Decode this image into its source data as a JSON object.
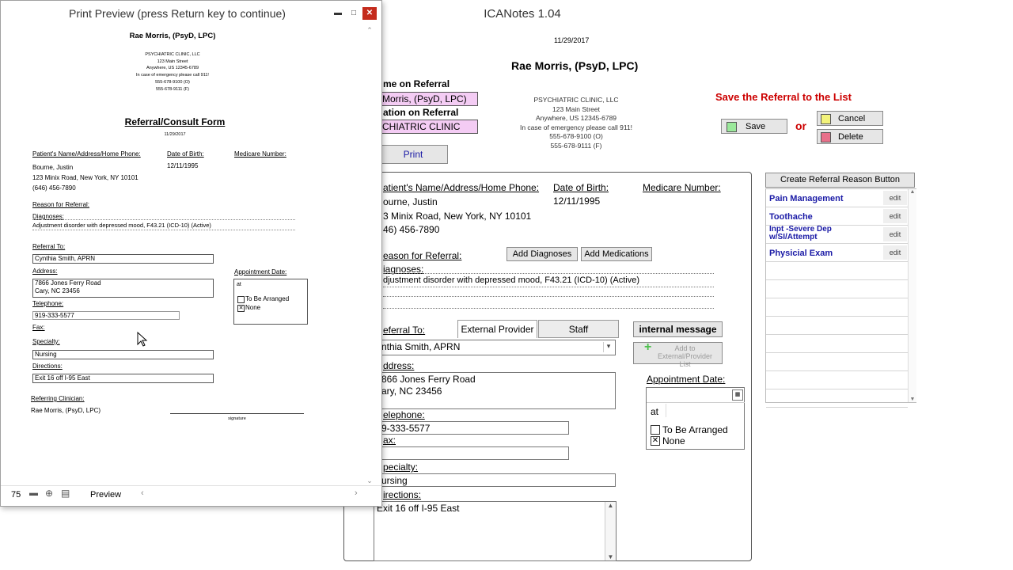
{
  "main_window": {
    "title": "ICANotes 1.04",
    "date": "11/29/2017",
    "clinician_name": "Rae Morris, (PsyD, LPC)",
    "clinic": {
      "lines": [
        "PSYCHIATRIC CLINIC, LLC",
        "123 Main Street",
        "Anywhere, US 12345-6789",
        "In case of emergency please call 911!",
        "555-678-9100 (O)",
        "555-678-9111 (F)"
      ]
    },
    "name_on_referral_label": "me on Referral",
    "name_on_referral_value": "Morris, (PsyD, LPC)",
    "location_on_referral_label": "ation on Referral",
    "location_on_referral_value": "CHIATRIC  CLINIC",
    "print_button": "Print",
    "save_heading": "Save the Referral to the List",
    "save_button": "Save",
    "or_text": "or",
    "cancel_button": "Cancel",
    "delete_button": "Delete",
    "patient_label": "atient's Name/Address/Home Phone:",
    "patient_lines": [
      "ourne, Justin",
      "3 Minix Road, New York, NY 10101",
      "46) 456-7890"
    ],
    "dob_label": "Date of Birth:",
    "dob_value": "12/11/1995",
    "medicare_label": "Medicare Number:",
    "reason_label": "eason for Referral:",
    "add_diagnoses_button": "Add Diagnoses",
    "add_medications_button": "Add Medications",
    "diagnoses_label": "iagnoses:",
    "diagnoses_value": "djustment disorder with depressed mood, F43.21 (ICD-10) (Active)",
    "referral_to_label": "eferral To:",
    "tab_external": "External Provider",
    "tab_staff": "Staff",
    "internal_message_button": "internal message",
    "add_to_list_button": "Add to External/Provider List",
    "referral_to_value": "nthia Smith, APRN",
    "address_label": "ddress:",
    "address_lines": [
      "866 Jones Ferry Road",
      "ary, NC  23456"
    ],
    "telephone_label": "elephone:",
    "telephone_value": "9-333-5577",
    "fax_label": "ax:",
    "specialty_label": "pecialty:",
    "specialty_value": "ursing",
    "directions_label": "irections:",
    "directions_value": "Exit 16 off I-95 East",
    "appointment_label": "Appointment Date:",
    "at_label": "at",
    "to_be_arranged": "To Be Arranged",
    "none_label": "None",
    "create_reason_button": "Create Referral Reason Button",
    "reasons": [
      {
        "label": "Pain Management",
        "edit": "edit"
      },
      {
        "label": "Toothache",
        "edit": "edit"
      },
      {
        "label": "Inpt -Severe Dep w/SI/Attempt",
        "edit": "edit"
      },
      {
        "label": "Physicial Exam",
        "edit": "edit"
      }
    ]
  },
  "preview_window": {
    "title": "Print Preview (press Return key to continue)",
    "clinician_name": "Rae Morris, (PsyD, LPC)",
    "clinic_lines": [
      "PSYCHIATRIC CLINIC, LLC",
      "123 Main Street",
      "Anywhere, US 12345-6789",
      "In case of emergency please call 911!",
      "555-678-9100 (O)",
      "555-678-9111 (F)"
    ],
    "form_title": "Referral/Consult Form",
    "date": "11/29/2017",
    "patient_label": "Patient's Name/Address/Home Phone:",
    "patient_lines": [
      "Bourne, Justin",
      "123 Minix Road, New York, NY 10101",
      "(646) 456-7890"
    ],
    "dob_label": "Date of Birth:",
    "dob_value": "12/11/1995",
    "medicare_label": "Medicare Number:",
    "reason_label": "Reason for Referral:",
    "diagnoses_label": "Diagnoses:",
    "diagnoses_value": "Adjustment disorder with depressed mood, F43.21 (ICD-10) (Active)",
    "referral_to_label": "Referral To:",
    "referral_to_value": "Cynthia Smith, APRN",
    "address_label": "Address:",
    "address_lines": [
      "7866 Jones Ferry Road",
      "Cary, NC  23456"
    ],
    "telephone_label": "Telephone:",
    "telephone_value": "919-333-5577",
    "fax_label": "Fax:",
    "specialty_label": "Specialty:",
    "specialty_value": "Nursing",
    "directions_label": "Directions:",
    "directions_value": "Exit 16 off I-95 East",
    "appointment_label": "Appointment Date:",
    "at_label": "at",
    "to_be_arranged": "To Be Arranged",
    "none_label": "None",
    "referring_label": "Referring Clinician:",
    "referring_value": "Rae Morris, (PsyD, LPC)",
    "signature_label": "signature",
    "zoom": "75",
    "mode": "Preview"
  }
}
